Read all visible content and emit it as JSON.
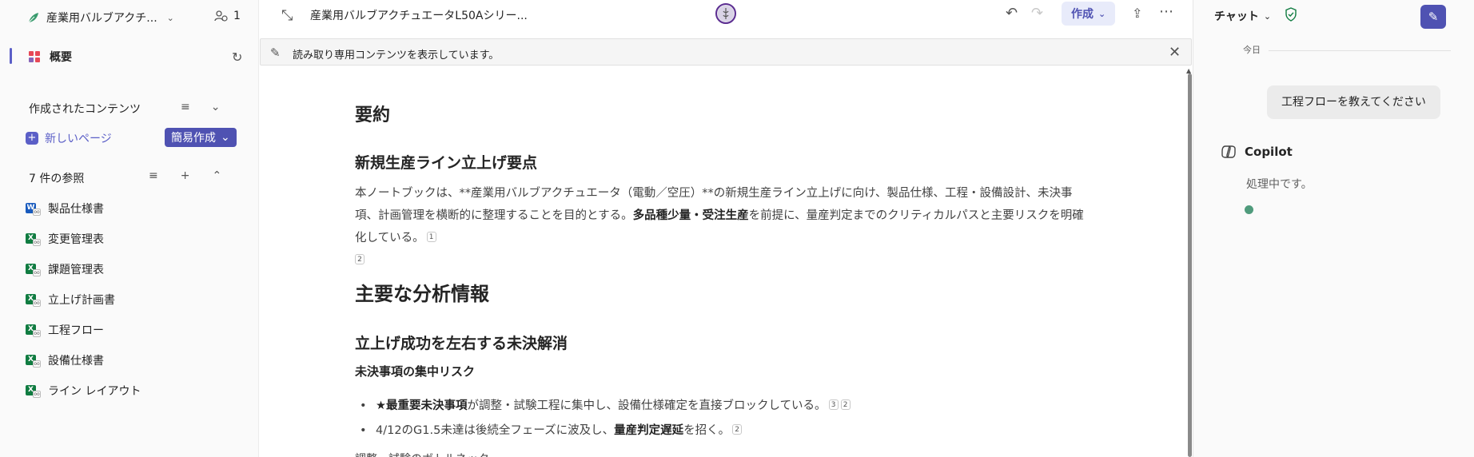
{
  "sidebar": {
    "notebook_title": "産業用バルブアクチ...",
    "member_count": "1",
    "overview_label": "概要",
    "created_section": {
      "title": "作成されたコンテンツ",
      "new_page_label": "新しいページ",
      "quick_create_label": "簡易作成"
    },
    "references_section": {
      "title": "7 件の参照",
      "items": [
        {
          "label": "製品仕様書",
          "icon": "word-link-icon"
        },
        {
          "label": "変更管理表",
          "icon": "excel-link-icon"
        },
        {
          "label": "課題管理表",
          "icon": "excel-link-icon"
        },
        {
          "label": "立上げ計画書",
          "icon": "excel-link-icon"
        },
        {
          "label": "工程フロー",
          "icon": "excel-link-icon"
        },
        {
          "label": "設備仕様書",
          "icon": "excel-link-icon"
        },
        {
          "label": "ライン レイアウト",
          "icon": "excel-link-icon"
        }
      ]
    }
  },
  "topbar": {
    "doc_title": "産業用バルブアクチュエータL50Aシリー...",
    "create_label": "作成"
  },
  "banner": {
    "text": "読み取り専用コンテンツを表示しています。"
  },
  "document": {
    "heading_summary": "要約",
    "heading_launch_points": "新規生産ライン立上げ要点",
    "para_part1": "本ノートブックは、**産業用バルブアクチュエータ（電動／空圧）**の新規生産ライン立上げに向け、製品仕様、工程・設備設計、未決事項、計画管理を横断的に整理することを目的とする。",
    "para_bold": "多品種少量・受注生産",
    "para_part2": "を前提に、量産判定までのクリティカルパスと主要リスクを明確化している。",
    "para_cite1": "1",
    "para_cite2": "2",
    "heading_main": "主要な分析情報",
    "heading_open_issues": "立上げ成功を左右する未決解消",
    "heading_risk": "未決事項の集中リスク",
    "bullet1_bold": "★最重要未決事項",
    "bullet1_text": "が調整・試験工程に集中し、設備仕様確定を直接ブロックしている。",
    "bullet1_cite1": "3",
    "bullet1_cite2": "2",
    "bullet2_text": "4/12のG1.5未達は後続全フェーズに波及し、",
    "bullet2_bold": "量産判定遅延",
    "bullet2_tail": "を招く。",
    "bullet2_cite": "2",
    "cut_line": "調整・試験のボトルネック"
  },
  "chat": {
    "tab_label": "チャット",
    "today_label": "今日",
    "user_message": "工程フローを教えてください",
    "assistant_name": "Copilot",
    "status_text": "処理中です。"
  },
  "colors": {
    "accent": "#5b5fc7",
    "excel_green": "#107c41",
    "word_blue": "#185abd"
  }
}
